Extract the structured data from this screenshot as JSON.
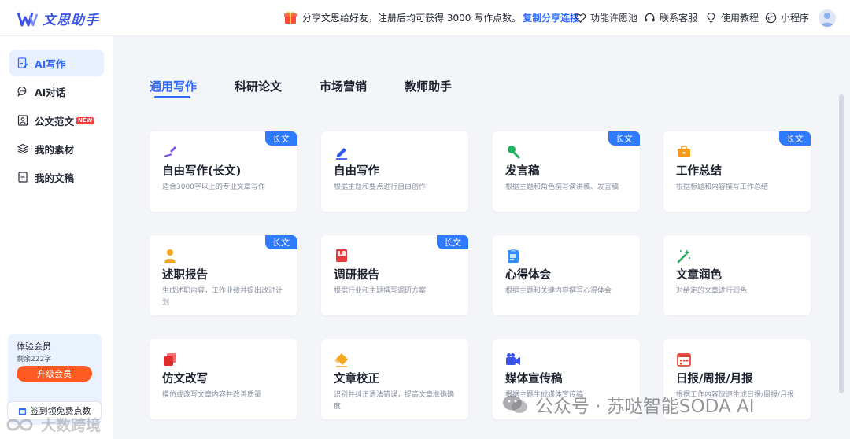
{
  "header": {
    "app_name": "文思助手",
    "promo_text": "分享文思给好友，注册后均可获得 3000 写作点数。",
    "promo_link": "复制分享连接",
    "nav": [
      "功能许愿池",
      "联系客服",
      "使用教程",
      "小程序"
    ]
  },
  "sidebar": {
    "items": [
      {
        "label": "AI写作",
        "icon": "edit-doc-icon",
        "active": true
      },
      {
        "label": "AI对话",
        "icon": "chat-bubble-icon"
      },
      {
        "label": "公文范文",
        "icon": "id-doc-icon",
        "badge": "NEW"
      },
      {
        "label": "我的素材",
        "icon": "layers-icon"
      },
      {
        "label": "我的文稿",
        "icon": "document-icon"
      }
    ],
    "member": {
      "title": "体验会员",
      "remaining": "剩余222字",
      "upgrade_label": "升级会员"
    },
    "signin_label": "签到领免费点数"
  },
  "tabs": [
    "通用写作",
    "科研论文",
    "市场营销",
    "教师助手"
  ],
  "badge_label": "长文",
  "cards": [
    {
      "title": "自由写作(长文)",
      "desc": "适合3000字以上的专业文章写作",
      "long": true,
      "icon": "pen-stroke-icon"
    },
    {
      "title": "自由写作",
      "desc": "根据主题和要点进行自由创作",
      "long": false,
      "icon": "pen-icon"
    },
    {
      "title": "发言稿",
      "desc": "根据主题和角色撰写演讲稿、发言稿",
      "long": true,
      "icon": "microphone-icon"
    },
    {
      "title": "工作总结",
      "desc": "根据标题和内容撰写工作总结",
      "long": true,
      "icon": "briefcase-icon"
    },
    {
      "title": "述职报告",
      "desc": "生成述职内容，工作业绩并提出改进计划",
      "long": true,
      "icon": "person-icon"
    },
    {
      "title": "调研报告",
      "desc": "根据行业和主题撰写调研方案",
      "long": true,
      "icon": "book-icon"
    },
    {
      "title": "心得体会",
      "desc": "根据主题和关键内容撰写心得体会",
      "long": false,
      "icon": "clipboard-icon"
    },
    {
      "title": "文章润色",
      "desc": "对给定的文章进行润色",
      "long": false,
      "icon": "magic-wand-icon"
    },
    {
      "title": "仿文改写",
      "desc": "模仿或改写文章内容并改善质量",
      "long": false,
      "icon": "copy-icon"
    },
    {
      "title": "文章校正",
      "desc": "识别并纠正语法错误，提高文章准确确度",
      "long": false,
      "icon": "eraser-icon"
    },
    {
      "title": "媒体宣传稿",
      "desc": "根据主题生成媒体宣传稿",
      "long": false,
      "icon": "video-camera-icon"
    },
    {
      "title": "日报/周报/月报",
      "desc": "根据工作内容快速生成日报/周报/月报",
      "long": false,
      "icon": "calendar-icon"
    }
  ],
  "watermarks": {
    "right": "公众号 · 苏哒智能SODA AI",
    "left": "大数跨境"
  }
}
